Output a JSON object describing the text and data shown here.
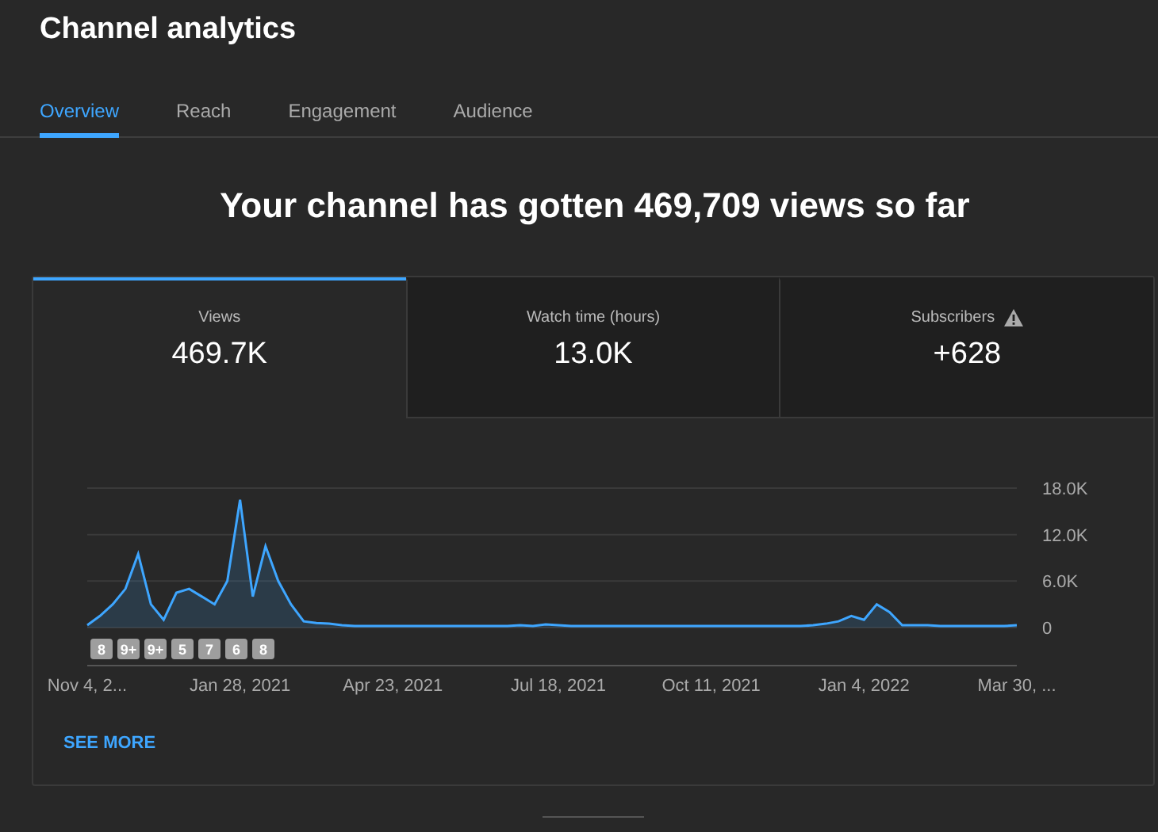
{
  "page": {
    "title": "Channel analytics"
  },
  "tabs": [
    {
      "label": "Overview",
      "selected": true
    },
    {
      "label": "Reach",
      "selected": false
    },
    {
      "label": "Engagement",
      "selected": false
    },
    {
      "label": "Audience",
      "selected": false
    }
  ],
  "headline": "Your channel has gotten 469,709 views so far",
  "metrics": [
    {
      "label": "Views",
      "value": "469.7K",
      "selected": true,
      "warning": false
    },
    {
      "label": "Watch time (hours)",
      "value": "13.0K",
      "selected": false,
      "warning": false
    },
    {
      "label": "Subscribers",
      "value": "+628",
      "selected": false,
      "warning": true
    }
  ],
  "chart_data": {
    "type": "area",
    "categories": [
      "Nov 4, 2...",
      null,
      null,
      null,
      null,
      null,
      null,
      null,
      null,
      null,
      null,
      null,
      "Jan 28, 2021",
      null,
      null,
      null,
      null,
      null,
      null,
      null,
      null,
      null,
      null,
      null,
      "Apr 23, 2021",
      null,
      null,
      null,
      null,
      null,
      null,
      null,
      null,
      null,
      null,
      null,
      null,
      "Jul 18, 2021",
      null,
      null,
      null,
      null,
      null,
      null,
      null,
      null,
      null,
      null,
      null,
      "Oct 11, 2021",
      null,
      null,
      null,
      null,
      null,
      null,
      null,
      null,
      null,
      null,
      null,
      "Jan 4, 2022",
      null,
      null,
      null,
      null,
      null,
      null,
      null,
      null,
      null,
      null,
      null,
      "Mar 30, ..."
    ],
    "series": [
      {
        "color": "#3ea6ff",
        "values": [
          300,
          1500,
          3000,
          5000,
          9500,
          3000,
          1000,
          4500,
          5000,
          4000,
          3000,
          6000,
          16500,
          4000,
          10500,
          6000,
          3000,
          800,
          600,
          500,
          300,
          200,
          200,
          200,
          200,
          200,
          200,
          200,
          200,
          200,
          200,
          200,
          200,
          200,
          300,
          200,
          400,
          300,
          200,
          200,
          200,
          200,
          200,
          200,
          200,
          200,
          200,
          200,
          200,
          200,
          200,
          200,
          200,
          200,
          200,
          200,
          200,
          300,
          500,
          800,
          1500,
          1000,
          3000,
          2000,
          300,
          300,
          300,
          200,
          200,
          200,
          200,
          200,
          200,
          300
        ]
      }
    ],
    "ylim": [
      0,
      18000
    ],
    "yticks": [
      {
        "value": 0,
        "label": "0"
      },
      {
        "value": 6000,
        "label": "6.0K"
      },
      {
        "value": 12000,
        "label": "12.0K"
      },
      {
        "value": 18000,
        "label": "18.0K"
      }
    ],
    "annotations": [
      "8",
      "9+",
      "9+",
      "5",
      "7",
      "6",
      "8"
    ]
  },
  "see_more": "SEE MORE"
}
